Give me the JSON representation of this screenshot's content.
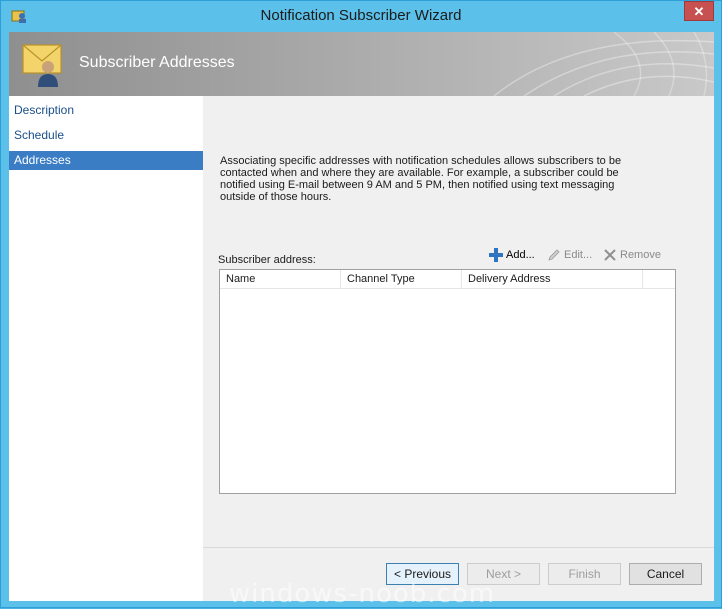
{
  "window": {
    "title": "Notification Subscriber Wizard",
    "close_label": "✕",
    "icon": "wizard-app-icon"
  },
  "header": {
    "title": "Subscriber Addresses",
    "icon": "subscriber-envelope-icon"
  },
  "nav": {
    "items": [
      {
        "label": "Description",
        "selected": false
      },
      {
        "label": "Schedule",
        "selected": false
      },
      {
        "label": "Addresses",
        "selected": true
      }
    ]
  },
  "main": {
    "description": "Associating specific addresses with notification schedules allows subscribers to be contacted when and where they are available. For example, a subscriber could be notified using E-mail between 9 AM and 5 PM, then notified using text messaging outside of those hours.",
    "address_label": "Subscriber address:",
    "actions": {
      "add": "Add...",
      "edit": "Edit...",
      "remove": "Remove"
    },
    "list": {
      "columns": [
        "Name",
        "Channel Type",
        "Delivery Address"
      ],
      "rows": []
    }
  },
  "buttons": {
    "previous": "< Previous",
    "next": "Next >",
    "finish": "Finish",
    "cancel": "Cancel"
  },
  "watermark": "windows-noob.com",
  "colors": {
    "accent": "#3b7dc5",
    "frame": "#5bc0ea"
  }
}
